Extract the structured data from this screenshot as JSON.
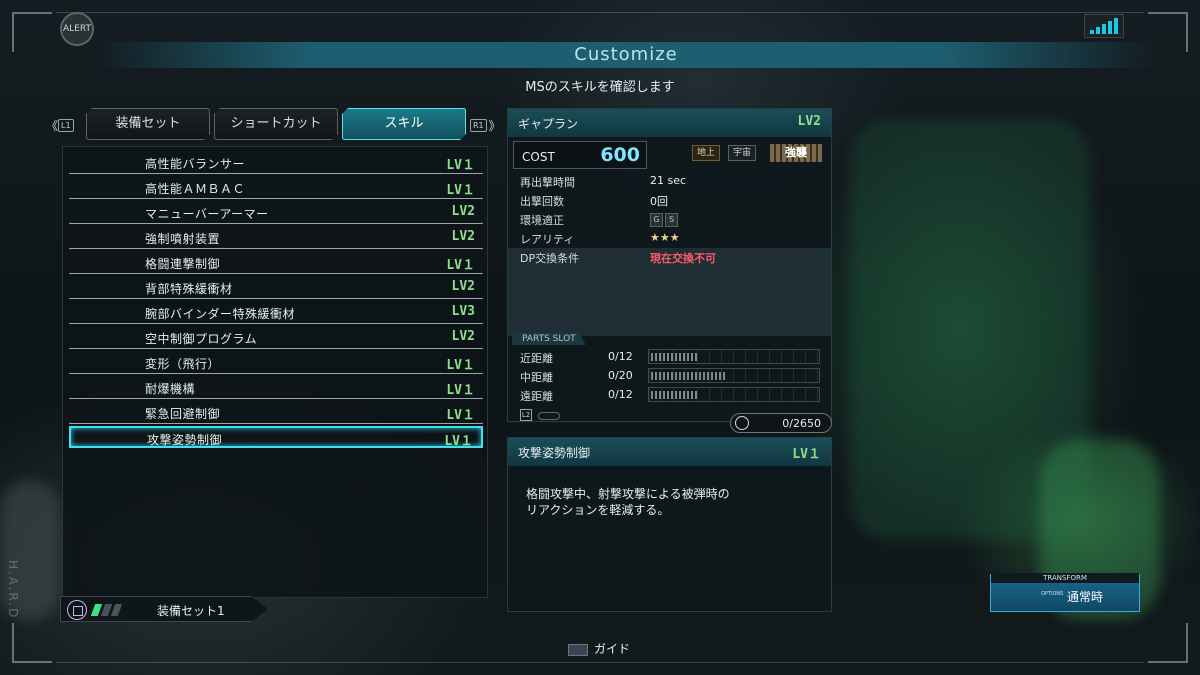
{
  "window": {
    "alert": "ALERT",
    "title": "Customize",
    "subtitle": "MSのスキルを確認します"
  },
  "tabs": {
    "prev_button": "L1",
    "next_button": "R1",
    "items": [
      {
        "label": "装備セット"
      },
      {
        "label": "ショートカット"
      },
      {
        "label": "スキル",
        "active": true
      }
    ]
  },
  "skills": [
    {
      "name": "高性能バランサー",
      "level": "LV１"
    },
    {
      "name": "高性能ＡＭＢＡＣ",
      "level": "LV１"
    },
    {
      "name": "マニューバーアーマー",
      "level": "LV2"
    },
    {
      "name": "強制噴射装置",
      "level": "LV2"
    },
    {
      "name": "格闘連撃制御",
      "level": "LV１"
    },
    {
      "name": "背部特殊緩衝材",
      "level": "LV2"
    },
    {
      "name": "腕部バインダー特殊緩衝材",
      "level": "LV3"
    },
    {
      "name": "空中制御プログラム",
      "level": "LV2"
    },
    {
      "name": "変形（飛行）",
      "level": "LV１"
    },
    {
      "name": "耐爆機構",
      "level": "LV１"
    },
    {
      "name": "緊急回避制御",
      "level": "LV１"
    },
    {
      "name": "攻撃姿勢制御",
      "level": "LV１",
      "selected": true
    }
  ],
  "loadout": {
    "label": "装備セット1",
    "slots_filled": 1,
    "slots_total": 3
  },
  "unit": {
    "name": "ギャプラン",
    "level": "LV2",
    "cost_label": "COST",
    "cost": "600",
    "env_ground": "地上",
    "env_space": "宇宙",
    "enhance": "強襲",
    "stats": [
      {
        "label": "再出撃時間",
        "value": "21 sec"
      },
      {
        "label": "出撃回数",
        "value": "0回"
      },
      {
        "label": "環境適正",
        "value": ""
      },
      {
        "label": "レアリティ",
        "value": "★★★"
      },
      {
        "label": "DP交換条件",
        "value": "現在交換不可"
      }
    ],
    "env_icons": [
      "G",
      "S"
    ],
    "parts_slot_label": "PARTS SLOT",
    "parts": [
      {
        "label": "近距離",
        "value": "0/12",
        "capacity": 12
      },
      {
        "label": "中距離",
        "value": "0/20",
        "capacity": 20
      },
      {
        "label": "遠距離",
        "value": "0/12",
        "capacity": 12
      }
    ],
    "l2_label": "L2",
    "points": "0/2650"
  },
  "detail": {
    "name": "攻撃姿勢制御",
    "level": "LV１",
    "description": "格闘攻撃中、射撃攻撃による被弾時の\nリアクションを軽減する。"
  },
  "transform": {
    "label": "TRANSFORM",
    "button": "OPTIONS",
    "value": "通常時"
  },
  "guide": {
    "label": "ガイド"
  },
  "side_text": "H.A.R.D"
}
